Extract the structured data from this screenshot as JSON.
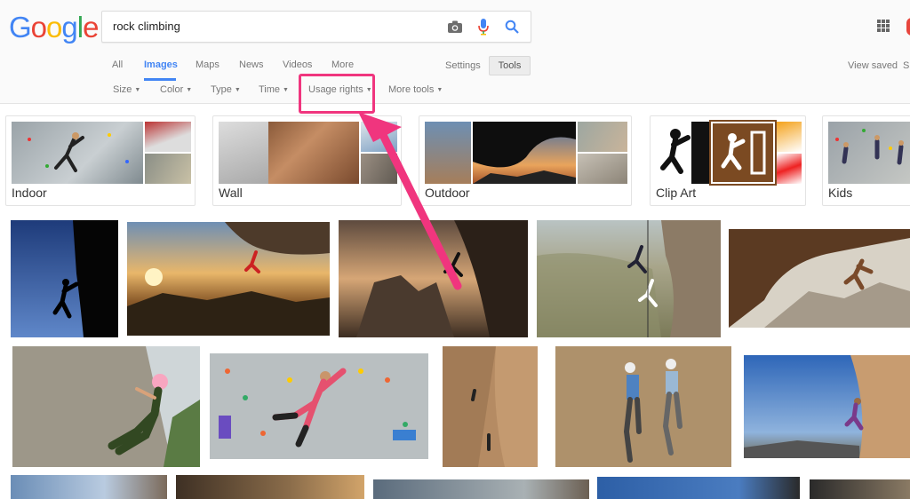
{
  "logo": {
    "letters": [
      "G",
      "o",
      "o",
      "g",
      "l",
      "e"
    ],
    "colors": [
      "#4285f4",
      "#ea4335",
      "#fbbc05",
      "#4285f4",
      "#34a853",
      "#ea4335"
    ]
  },
  "search": {
    "query": "rock climbing",
    "icons": [
      "camera-icon",
      "microphone-icon",
      "search-icon"
    ]
  },
  "tabs": [
    {
      "label": "All"
    },
    {
      "label": "Images"
    },
    {
      "label": "Maps"
    },
    {
      "label": "News"
    },
    {
      "label": "Videos"
    },
    {
      "label": "More"
    }
  ],
  "settings_label": "Settings",
  "tools_label": "Tools",
  "view_saved_label": "View saved",
  "safe_edge_label": "S",
  "filters": [
    {
      "label": "Size"
    },
    {
      "label": "Color"
    },
    {
      "label": "Type"
    },
    {
      "label": "Time"
    },
    {
      "label": "Usage rights"
    },
    {
      "label": "More tools"
    }
  ],
  "categories": [
    {
      "label": "Indoor"
    },
    {
      "label": "Wall"
    },
    {
      "label": "Outdoor"
    },
    {
      "label": "Clip Art"
    },
    {
      "label": "Kids"
    }
  ],
  "colors": {
    "accent": "#4285f4",
    "highlight": "#f0357e"
  }
}
